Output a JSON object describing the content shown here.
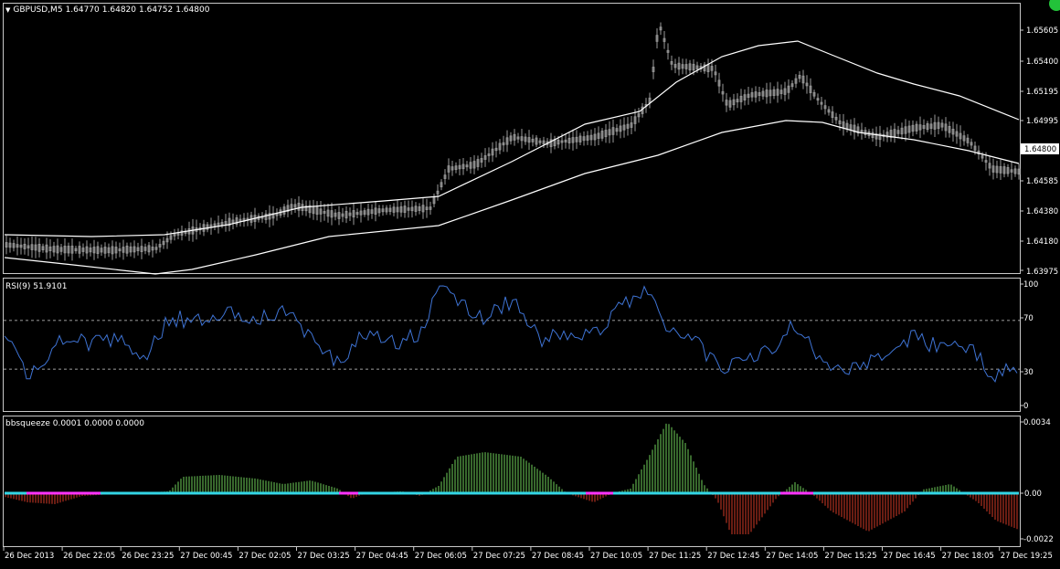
{
  "window": {
    "symbol": "GBPUSD,M5",
    "ohlc": [
      "1.64770",
      "1.64820",
      "1.64752",
      "1.64800"
    ],
    "current_price": "1.64800"
  },
  "main_chart": {
    "price_ticks": [
      "1.65605",
      "1.65400",
      "1.65195",
      "1.64995",
      "1.64585",
      "1.64380",
      "1.64180",
      "1.63975"
    ]
  },
  "rsi": {
    "label": "RSI(9) 51.9101",
    "ticks": [
      "100",
      "70",
      "30",
      "0"
    ],
    "levels": [
      70,
      30
    ]
  },
  "bbsqueeze": {
    "label": "bbsqueeze 0.0001 0.0000 0.0000",
    "ticks": [
      "0.0034",
      "0.00",
      "-0.0022"
    ]
  },
  "time_axis": {
    "labels": [
      "26 Dec 2013",
      "26 Dec 22:05",
      "26 Dec 23:25",
      "27 Dec 00:45",
      "27 Dec 02:05",
      "27 Dec 03:25",
      "27 Dec 04:45",
      "27 Dec 06:05",
      "27 Dec 07:25",
      "27 Dec 08:45",
      "27 Dec 10:05",
      "27 Dec 11:25",
      "27 Dec 12:45",
      "27 Dec 14:05",
      "27 Dec 15:25",
      "27 Dec 16:45",
      "27 Dec 18:05",
      "27 Dec 19:25"
    ]
  },
  "colors": {
    "background": "#000000",
    "axis": "#c8c8c8",
    "candles": "#9a9a9a",
    "bands": "#ffffff",
    "rsi_line": "#3e73d4",
    "hist_positive": "#6fcf5a",
    "hist_negative": "#d23a26",
    "squeeze_on": "#ff33ff",
    "squeeze_off": "#33d6e6"
  }
}
